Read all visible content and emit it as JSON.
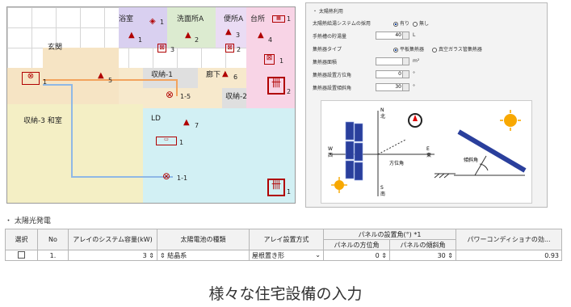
{
  "floorplan": {
    "rooms": [
      {
        "id": "bath",
        "label": "浴室",
        "color": "#d9d0f0"
      },
      {
        "id": "wash",
        "label": "洗面所A",
        "color": "#dcebd0"
      },
      {
        "id": "toilet",
        "label": "便所A",
        "color": "#eadcf4"
      },
      {
        "id": "kitchen",
        "label": "台所",
        "color": "#f8d4e6"
      },
      {
        "id": "entrance",
        "label": "玄関",
        "color": "#f6e4c4"
      },
      {
        "id": "storage1",
        "label": "収納-1",
        "color": "#dfdfdf"
      },
      {
        "id": "hall",
        "label": "廊下",
        "color": "#f7e9cc"
      },
      {
        "id": "storage2",
        "label": "収納-2",
        "color": "#dfdfdf"
      },
      {
        "id": "japanese",
        "label": "収納-3 和室",
        "color": "#f4efc5"
      },
      {
        "id": "ld",
        "label": "LD",
        "color": "#d2f0f4"
      }
    ],
    "marks": {
      "bath_lamp": "1",
      "bath_vent": "1",
      "wash_lamp": "2",
      "wash_fan": "3",
      "toilet_lamp": "3",
      "toilet_fan": "2",
      "kitchen_lamp": "4",
      "kitchen_hood": "1",
      "kitchen_fan": "1",
      "kitchen_heater": "2",
      "entrance_lamp": "5",
      "entrance_unit": "1",
      "hall_lamp": "6",
      "ceiling_a": "1-5",
      "ld_lamp": "7",
      "ld_ac": "1",
      "ceiling_b": "1-1",
      "ld_heater": "1"
    }
  },
  "solar_heat": {
    "section": "太陽熱利用",
    "use_label": "太陽熱給湯システムの採用",
    "use_yes": "有り",
    "use_no": "無し",
    "tank_label": "手熱槽の貯湯量",
    "tank_value": "40",
    "tank_unit": "L",
    "type_label": "集熱器タイプ",
    "type_opt1": "平板集熱器",
    "type_opt2": "真空ガラス管集熱器",
    "area_label": "集熱器面積",
    "area_value": "4",
    "area_unit": "m²",
    "azimuth_label": "集熱器設置方位角",
    "azimuth_value": "0",
    "azimuth_unit": "°",
    "tilt_label": "集熱器設置傾斜角",
    "tilt_value": "30",
    "tilt_unit": "°",
    "diagram": {
      "n": "N",
      "s": "S",
      "e": "E",
      "w": "W",
      "n_jp": "北",
      "s_jp": "南",
      "e_jp": "東",
      "w_jp": "西",
      "azimuth": "方位角",
      "tilt": "傾斜角"
    }
  },
  "pv": {
    "section": "太陽光発電",
    "headers": {
      "select": "選択",
      "no": "No",
      "capacity": "アレイのシステム容量(kW)",
      "cell": "太陽電池の種類",
      "method": "アレイ設置方式",
      "panel": "パネルの設置角(°) *1",
      "azimuth": "パネルの方位角",
      "tilt": "パネルの傾斜角",
      "pcs": "パワーコンディショナの効..."
    },
    "rows": [
      {
        "no": "1.",
        "capacity": "3",
        "cell": "結晶系",
        "method": "屋根置き形",
        "azimuth": "0",
        "tilt": "30",
        "pcs": "0.93"
      }
    ]
  },
  "caption": "様々な住宅設備の入力"
}
